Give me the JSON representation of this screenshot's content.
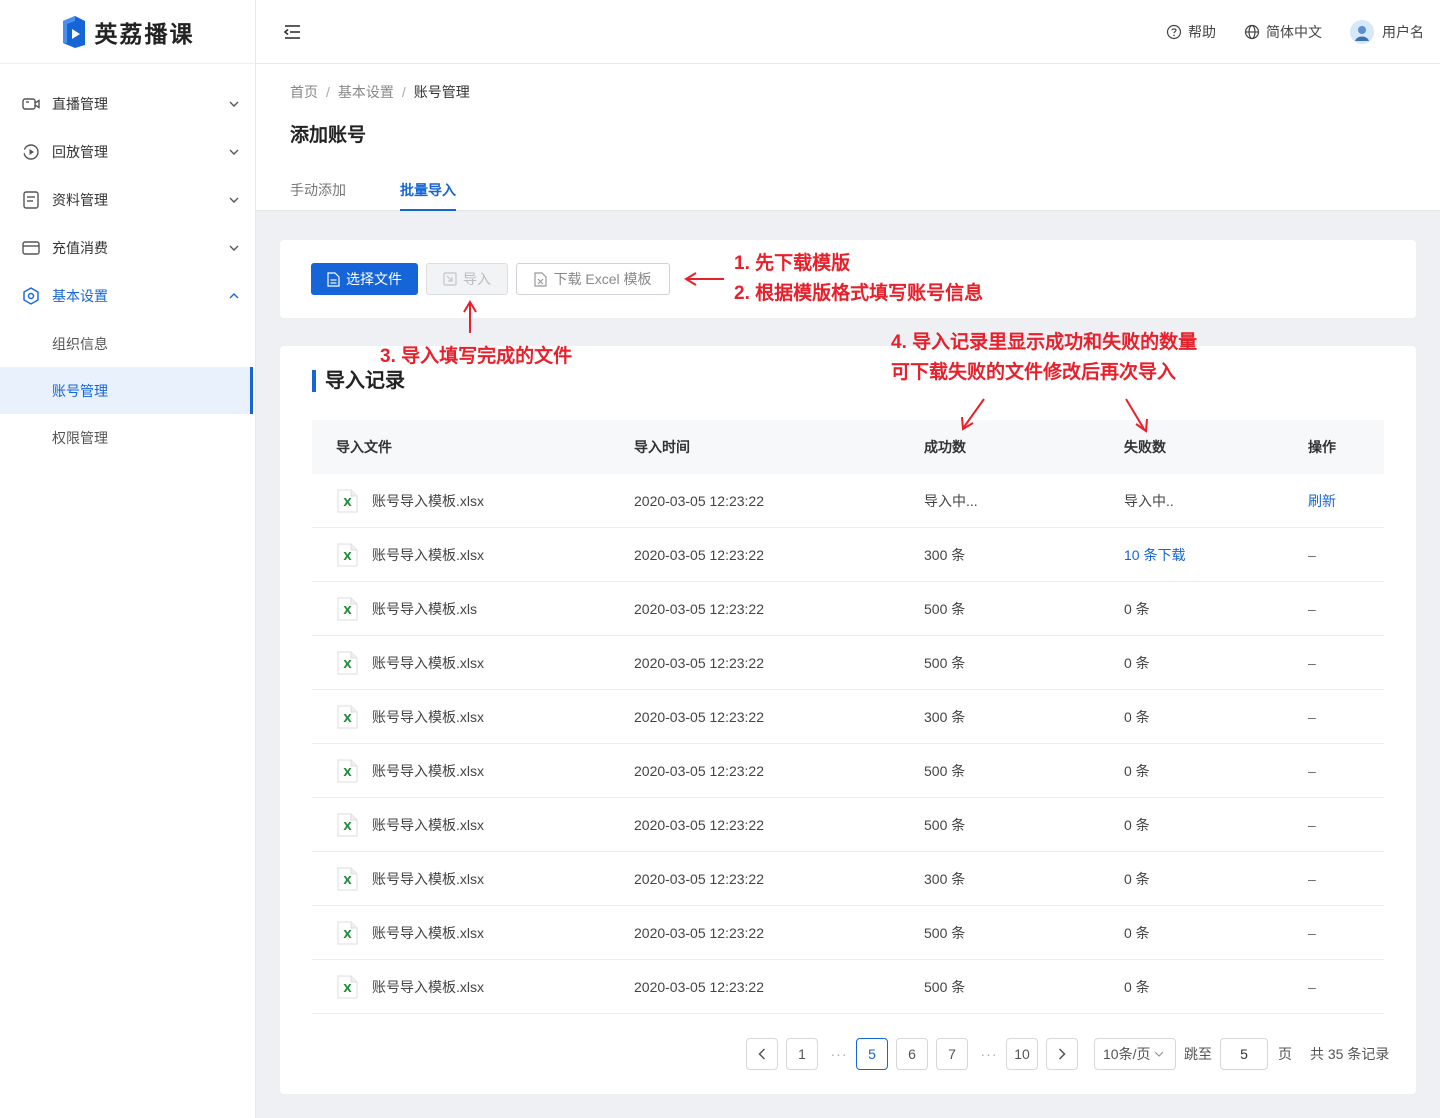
{
  "app": {
    "name": "英荔播课"
  },
  "sidebar": {
    "items": [
      {
        "label": "直播管理",
        "icon": "video-camera-icon"
      },
      {
        "label": "回放管理",
        "icon": "replay-icon"
      },
      {
        "label": "资料管理",
        "icon": "document-icon"
      },
      {
        "label": "充值消费",
        "icon": "wallet-icon"
      },
      {
        "label": "基本设置",
        "icon": "settings-icon"
      }
    ],
    "subitems": [
      {
        "label": "组织信息"
      },
      {
        "label": "账号管理"
      },
      {
        "label": "权限管理"
      }
    ]
  },
  "header": {
    "help": "帮助",
    "language": "简体中文",
    "username": "用户名"
  },
  "breadcrumb": {
    "home": "首页",
    "parent": "基本设置",
    "current": "账号管理"
  },
  "page": {
    "title": "添加账号"
  },
  "tabs": {
    "manual": "手动添加",
    "batch": "批量导入"
  },
  "toolbar": {
    "choose_file": "选择文件",
    "import": "导入",
    "download_template": "下载 Excel 模板"
  },
  "annotations": {
    "a1": "1. 先下载模版",
    "a2": "2. 根据模版格式填写账号信息",
    "a3": "3. 导入填写完成的文件",
    "a4_line1": "4. 导入记录里显示成功和失败的数量",
    "a4_line2": "可下载失败的文件修改后再次导入",
    "color": "#e8202b"
  },
  "records": {
    "title": "导入记录",
    "headers": {
      "file": "导入文件",
      "time": "导入时间",
      "success": "成功数",
      "fail": "失败数",
      "action": "操作"
    },
    "rows": [
      {
        "file": "账号导入模板.xlsx",
        "time": "2020-03-05 12:23:22",
        "success": "导入中...",
        "fail": "导入中..",
        "action": "刷新"
      },
      {
        "file": "账号导入模板.xlsx",
        "time": "2020-03-05 12:23:22",
        "success": "300 条",
        "fail": "10 条下载",
        "action": "–"
      },
      {
        "file": "账号导入模板.xls",
        "time": "2020-03-05 12:23:22",
        "success": "500 条",
        "fail": "0 条",
        "action": "–"
      },
      {
        "file": "账号导入模板.xlsx",
        "time": "2020-03-05 12:23:22",
        "success": "500 条",
        "fail": "0 条",
        "action": "–"
      },
      {
        "file": "账号导入模板.xlsx",
        "time": "2020-03-05 12:23:22",
        "success": "300 条",
        "fail": "0 条",
        "action": "–"
      },
      {
        "file": "账号导入模板.xlsx",
        "time": "2020-03-05 12:23:22",
        "success": "500 条",
        "fail": "0 条",
        "action": "–"
      },
      {
        "file": "账号导入模板.xlsx",
        "time": "2020-03-05 12:23:22",
        "success": "500 条",
        "fail": "0 条",
        "action": "–"
      },
      {
        "file": "账号导入模板.xlsx",
        "time": "2020-03-05 12:23:22",
        "success": "300 条",
        "fail": "0 条",
        "action": "–"
      },
      {
        "file": "账号导入模板.xlsx",
        "time": "2020-03-05 12:23:22",
        "success": "500 条",
        "fail": "0 条",
        "action": "–"
      },
      {
        "file": "账号导入模板.xlsx",
        "time": "2020-03-05 12:23:22",
        "success": "500 条",
        "fail": "0 条",
        "action": "–"
      }
    ]
  },
  "pagination": {
    "pages": [
      "1",
      "5",
      "6",
      "7",
      "10"
    ],
    "current": "5",
    "dots": "···",
    "page_size": "10条/页",
    "jump_label": "跳至",
    "jump_value": "5",
    "page_unit": "页",
    "total": "共 35 条记录"
  },
  "colors": {
    "primary": "#1565d8",
    "excel_green": "#1f8f3a"
  }
}
